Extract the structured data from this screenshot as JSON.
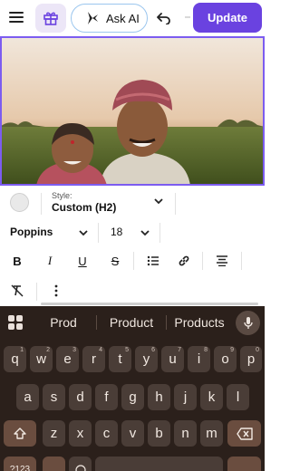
{
  "toolbar": {
    "menu_icon": "hamburger-menu-icon",
    "gift_icon": "gift-icon",
    "ask_ai_label": "Ask AI",
    "undo_icon": "undo-icon",
    "update_label": "Update",
    "update_color": "#6a42e0"
  },
  "editor": {
    "style_label": "Style:",
    "style_value": "Custom (H2)",
    "font_name": "Poppins",
    "font_size": "18",
    "format_buttons": [
      "bold-icon",
      "italic-icon",
      "underline-icon",
      "strikethrough-icon",
      "bulleted-list-icon",
      "link-icon",
      "align-center-icon",
      "clear-formatting-icon",
      "more-options-icon"
    ]
  },
  "keyboard": {
    "suggestions": [
      "Prod",
      "Product",
      "Products"
    ],
    "row1": [
      "q",
      "w",
      "e",
      "r",
      "t",
      "y",
      "u",
      "i",
      "o",
      "p"
    ],
    "row1_sup": [
      "1",
      "2",
      "3",
      "4",
      "5",
      "6",
      "7",
      "8",
      "9",
      "0"
    ],
    "row2": [
      "a",
      "s",
      "d",
      "f",
      "g",
      "h",
      "j",
      "k",
      "l"
    ],
    "row3": [
      "z",
      "x",
      "c",
      "v",
      "b",
      "n",
      "m"
    ],
    "bottom_left": "?123"
  }
}
